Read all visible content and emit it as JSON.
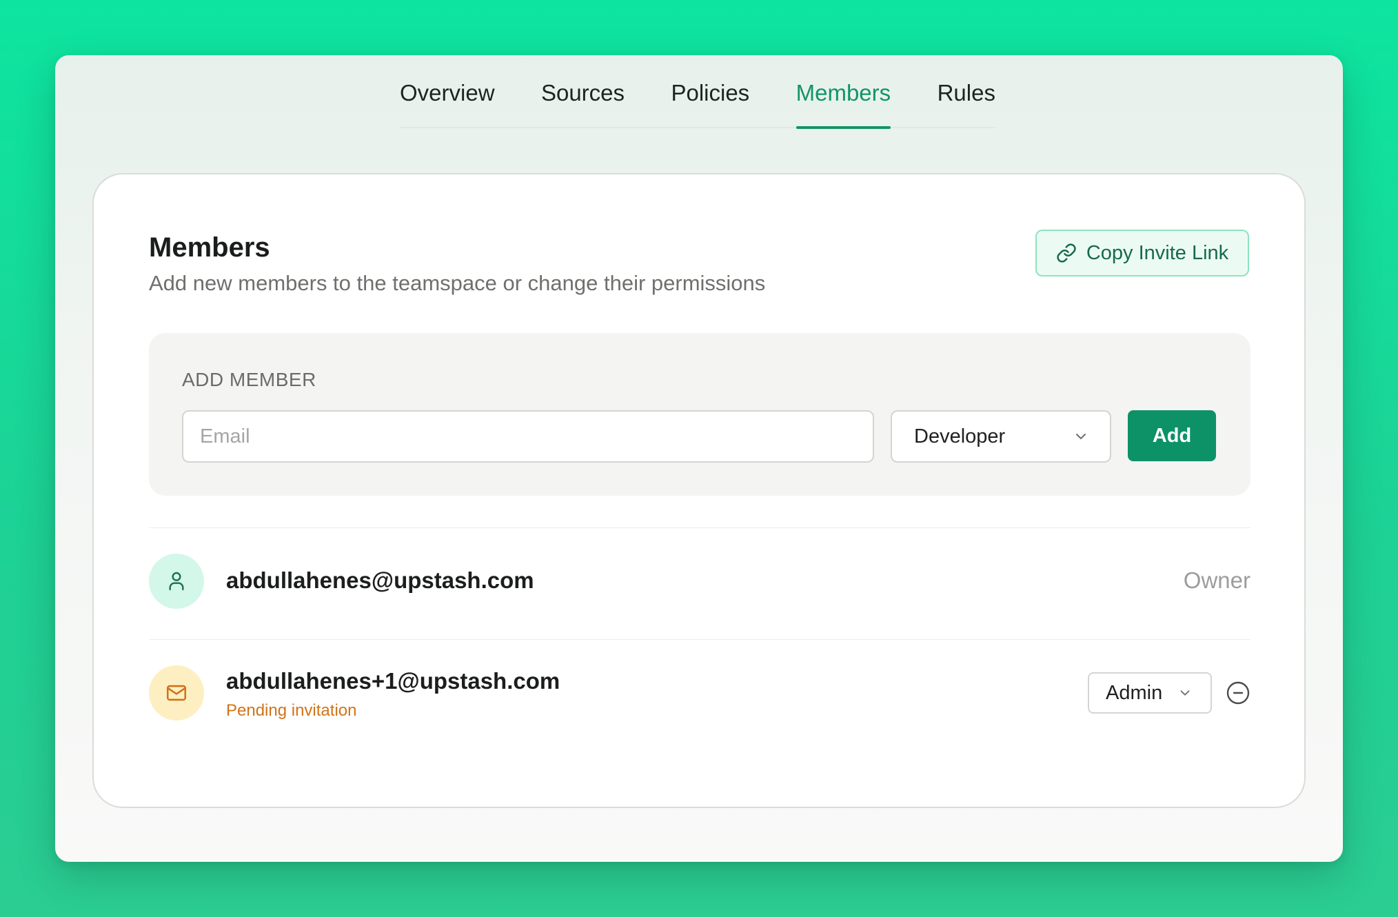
{
  "tabs": [
    {
      "label": "Overview",
      "active": false
    },
    {
      "label": "Sources",
      "active": false
    },
    {
      "label": "Policies",
      "active": false
    },
    {
      "label": "Members",
      "active": true
    },
    {
      "label": "Rules",
      "active": false
    }
  ],
  "card": {
    "title": "Members",
    "subtitle": "Add new members to the teamspace or change their permissions",
    "copy_invite_label": "Copy Invite Link"
  },
  "add_member": {
    "label": "ADD MEMBER",
    "email_placeholder": "Email",
    "email_value": "",
    "role_selected": "Developer",
    "add_label": "Add"
  },
  "members": [
    {
      "email": "abdullahenes@upstash.com",
      "role": "Owner",
      "status": "",
      "avatar_icon": "user-icon"
    },
    {
      "email": "abdullahenes+1@upstash.com",
      "role": "Admin",
      "status": "Pending invitation",
      "avatar_icon": "mail-icon"
    }
  ],
  "colors": {
    "accent": "#0d9268",
    "background": "#0de59f",
    "pending": "#d07318"
  }
}
